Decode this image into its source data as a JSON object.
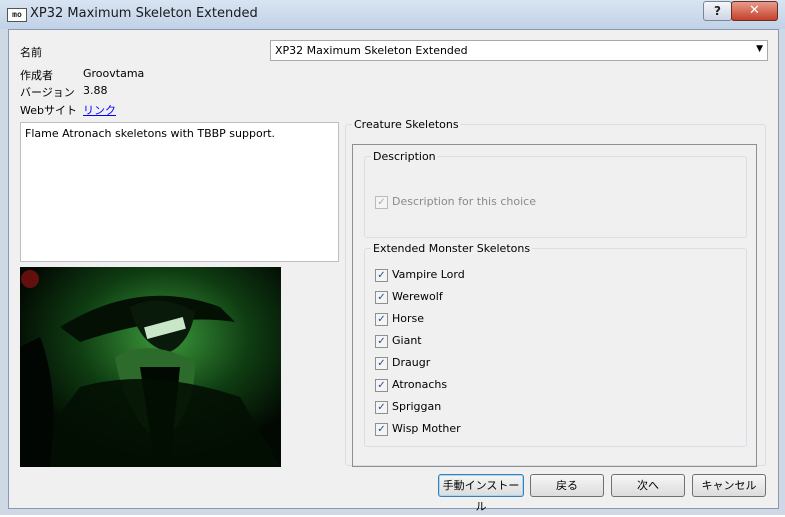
{
  "window": {
    "icon": "mo",
    "title": "XP32 Maximum Skeleton Extended",
    "help_label": "?",
    "close_label": "✕"
  },
  "info": {
    "name_label": "名前",
    "name_value": "XP32 Maximum Skeleton Extended",
    "author_label": "作成者",
    "author_value": "Groovtama",
    "version_label": "バージョン",
    "version_value": "3.88",
    "website_label": "Webサイト",
    "website_link": "リンク"
  },
  "description_text": "Flame Atronach skeletons with TBBP support.",
  "group": {
    "title": "Creature Skeletons",
    "description_section": {
      "title": "Description",
      "checkbox": {
        "label": "Description for this choice",
        "checked": true,
        "disabled": true
      }
    },
    "options_section": {
      "title": "Extended Monster Skeletons",
      "items": [
        {
          "label": "Vampire Lord",
          "checked": true
        },
        {
          "label": "Werewolf",
          "checked": true
        },
        {
          "label": "Horse",
          "checked": true
        },
        {
          "label": "Giant",
          "checked": true
        },
        {
          "label": "Draugr",
          "checked": true
        },
        {
          "label": "Atronachs",
          "checked": true
        },
        {
          "label": "Spriggan",
          "checked": true
        },
        {
          "label": "Wisp Mother",
          "checked": true
        }
      ]
    }
  },
  "buttons": {
    "manual": "手動インストール",
    "back": "戻る",
    "next": "次へ",
    "cancel": "キャンセル"
  },
  "icons": {
    "dropdown": "chevron-down-icon",
    "checkmark": "checkmark-icon"
  }
}
